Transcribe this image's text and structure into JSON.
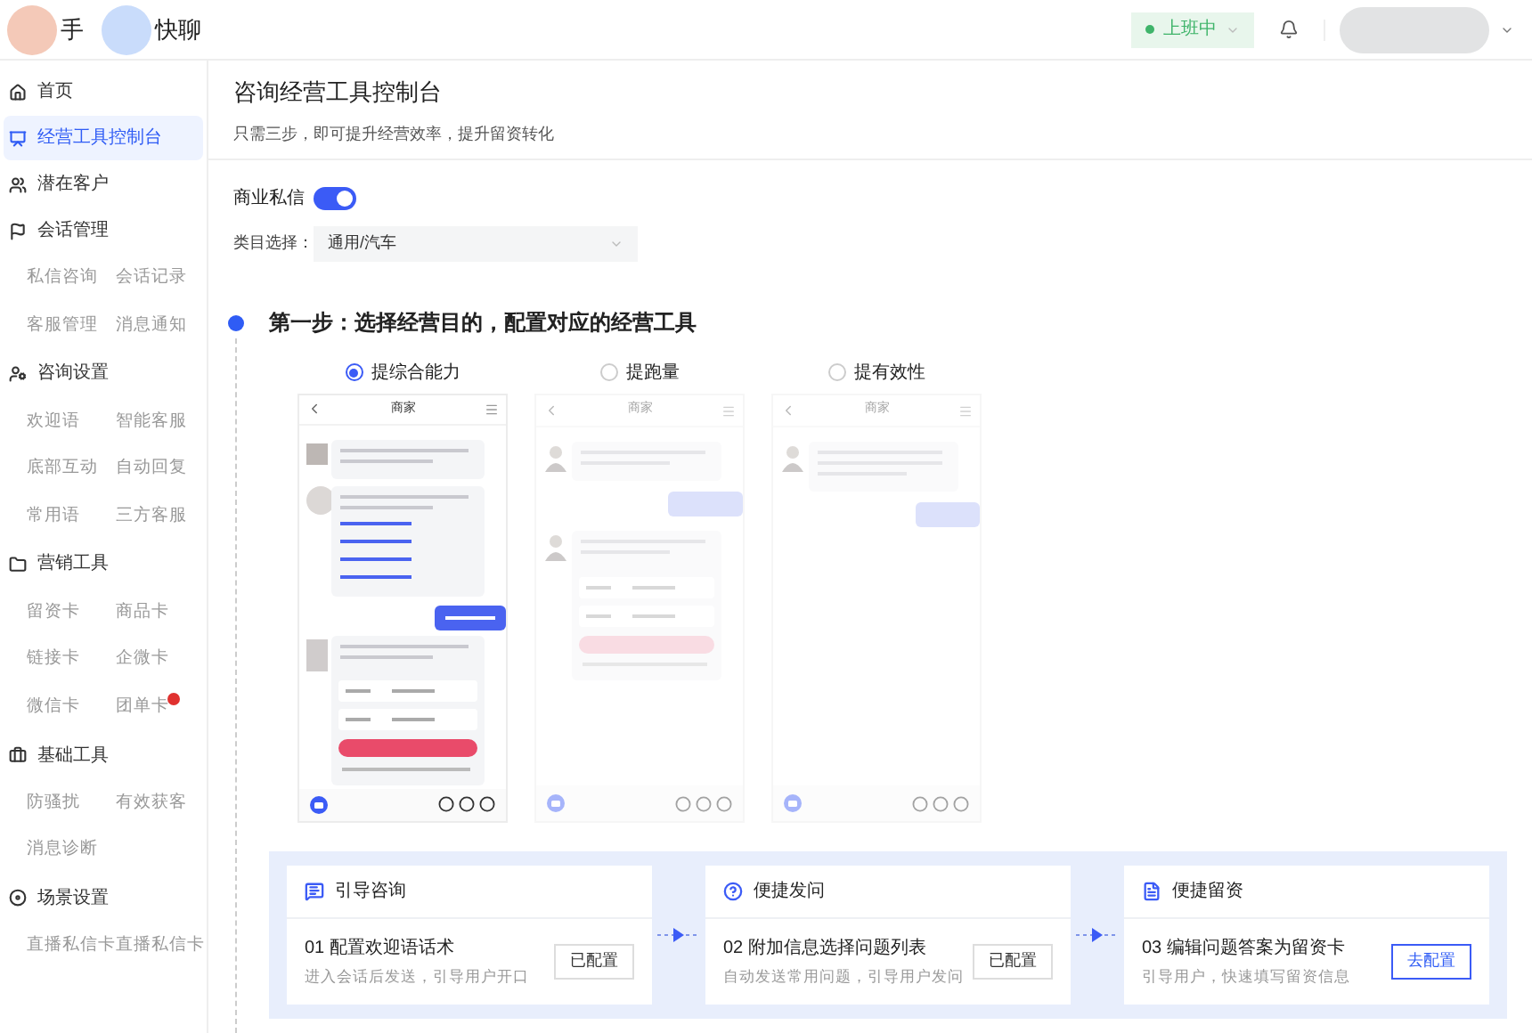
{
  "header": {
    "logos": [
      {
        "text": "手"
      },
      {
        "text": "快聊"
      }
    ],
    "status": {
      "label": "上班中",
      "on": true
    }
  },
  "sidebar": {
    "groups": [
      {
        "label": "首页",
        "selected": false
      },
      {
        "label": "经营工具控制台",
        "selected": true
      },
      {
        "label": "潜在客户",
        "selected": false
      },
      {
        "label": "会话管理",
        "selected": false,
        "children": [
          {
            "label": "私信咨询"
          },
          {
            "label": "会话记录"
          },
          {
            "label": "客服管理"
          },
          {
            "label": "消息通知"
          }
        ]
      },
      {
        "label": "咨询设置",
        "selected": false,
        "children": [
          {
            "label": "欢迎语"
          },
          {
            "label": "智能客服"
          },
          {
            "label": "底部互动"
          },
          {
            "label": "自动回复"
          },
          {
            "label": "常用语"
          },
          {
            "label": "三方客服"
          }
        ]
      },
      {
        "label": "营销工具",
        "selected": false,
        "children": [
          {
            "label": "留资卡"
          },
          {
            "label": "商品卡"
          },
          {
            "label": "链接卡"
          },
          {
            "label": "企微卡"
          },
          {
            "label": "微信卡"
          },
          {
            "label": "团单卡",
            "badge": true
          }
        ]
      },
      {
        "label": "基础工具",
        "selected": false,
        "children": [
          {
            "label": "防骚扰"
          },
          {
            "label": "有效获客"
          },
          {
            "label": "消息诊断"
          }
        ]
      },
      {
        "label": "场景设置",
        "selected": false,
        "children": [
          {
            "label": "直播私信卡"
          },
          {
            "label": "直播私信卡"
          }
        ]
      }
    ]
  },
  "page": {
    "title": "咨询经营工具控制台",
    "subtitle": "只需三步，即可提升经营效率，提升留资转化"
  },
  "business_dm": {
    "label": "商业私信",
    "on": true
  },
  "category": {
    "label": "类目选择：",
    "value": "通用/汽车"
  },
  "step": {
    "title": "第一步：选择经营目的，配置对应的经营工具"
  },
  "purposes": [
    {
      "label": "提综合能力",
      "selected": true,
      "preview": {
        "title": "商家"
      }
    },
    {
      "label": "提跑量",
      "selected": false,
      "preview": {
        "title": "商家"
      }
    },
    {
      "label": "提有效性",
      "selected": false,
      "preview": {
        "title": "商家"
      }
    }
  ],
  "tools": [
    {
      "kind": "chat",
      "header": "引导咨询",
      "title": "01 配置欢迎语话术",
      "desc": "进入会话后发送，引导用户开口",
      "button": {
        "label": "已配置",
        "configured": true
      }
    },
    {
      "kind": "question",
      "header": "便捷发问",
      "title": "02 附加信息选择问题列表",
      "desc": "自动发送常用问题，引导用户发问",
      "button": {
        "label": "已配置",
        "configured": true
      }
    },
    {
      "kind": "form",
      "header": "便捷留资",
      "title": "03 编辑问题答案为留资卡",
      "desc": "引导用户，快速填写留资信息",
      "button": {
        "label": "去配置",
        "configured": false
      }
    }
  ]
}
